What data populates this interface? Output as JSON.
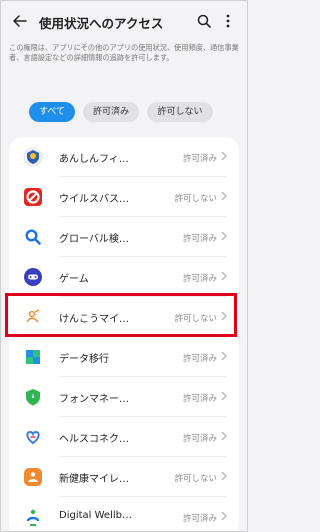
{
  "header": {
    "title": "使用状況へのアクセス",
    "back_icon": "back-arrow-icon",
    "search_icon": "search-icon",
    "more_icon": "more-vertical-icon"
  },
  "description": "この権限は、アプリにその他のアプリの使用状況、使用頻度、通信事業者、言語設定などの詳細情報の追跡を許可します。",
  "filters": {
    "all": "すべて",
    "allowed": "許可済み",
    "not_allowed": "許可しない",
    "active": "all"
  },
  "apps": [
    {
      "name": "あんしんフィ…",
      "status": "許可済み",
      "icon": "shield-app-icon"
    },
    {
      "name": "ウイルスバス…",
      "status": "許可しない",
      "icon": "virus-buster-icon"
    },
    {
      "name": "グローバル検…",
      "status": "許可済み",
      "icon": "search-app-icon"
    },
    {
      "name": "ゲーム",
      "status": "許可済み",
      "icon": "gamepad-icon"
    },
    {
      "name": "けんこうマイ…",
      "status": "許可しない",
      "icon": "health-mileage-icon"
    },
    {
      "name": "データ移行",
      "status": "許可済み",
      "icon": "data-transfer-icon"
    },
    {
      "name": "フォンマネー…",
      "status": "許可済み",
      "icon": "phone-manager-icon"
    },
    {
      "name": "ヘルスコネク…",
      "status": "許可済み",
      "icon": "health-connect-icon"
    },
    {
      "name": "新健康マイレ…",
      "status": "許可しない",
      "icon": "new-health-mileage-icon"
    },
    {
      "name": "Digital Wellb…",
      "status": "許可済み",
      "icon": "digital-wellbeing-icon"
    }
  ],
  "colors": {
    "accent": "#1e8fea",
    "highlight": "#e0001a"
  }
}
